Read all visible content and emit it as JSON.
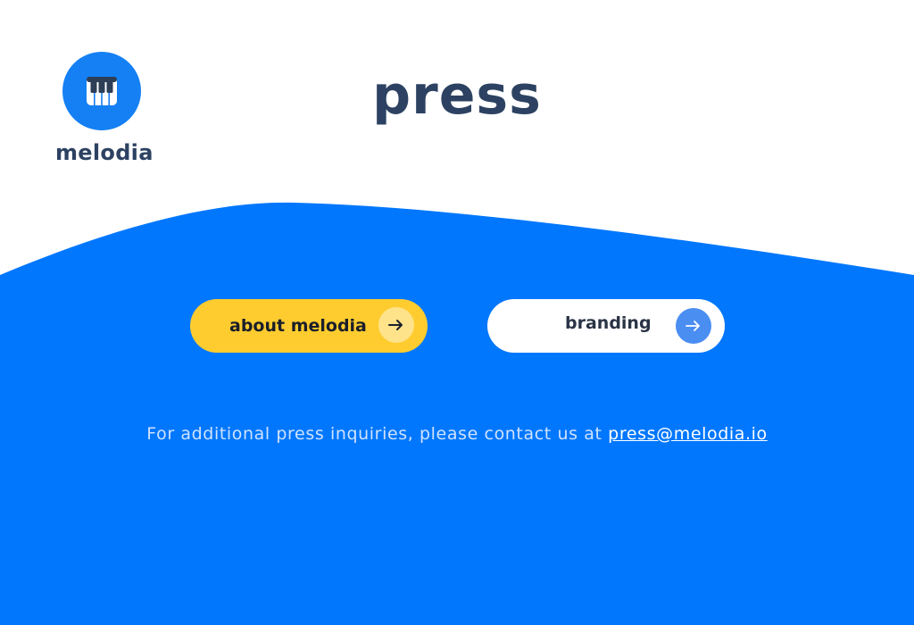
{
  "brand": {
    "name": "melodia",
    "logo_icon": "piano-keys-icon",
    "accent_color": "#1580f3"
  },
  "page": {
    "title": "press"
  },
  "buttons": [
    {
      "label": "about melodia",
      "icon": "arrow-right-icon",
      "color": "#ffcc2f"
    },
    {
      "label": "branding",
      "icon": "arrow-right-icon",
      "color": "#ffffff"
    }
  ],
  "contact": {
    "text": "For additional press inquiries, please contact us at ",
    "email": "press@melodia.io"
  },
  "colors": {
    "background_wave": "#0177fd",
    "title_text": "#2d4262"
  }
}
